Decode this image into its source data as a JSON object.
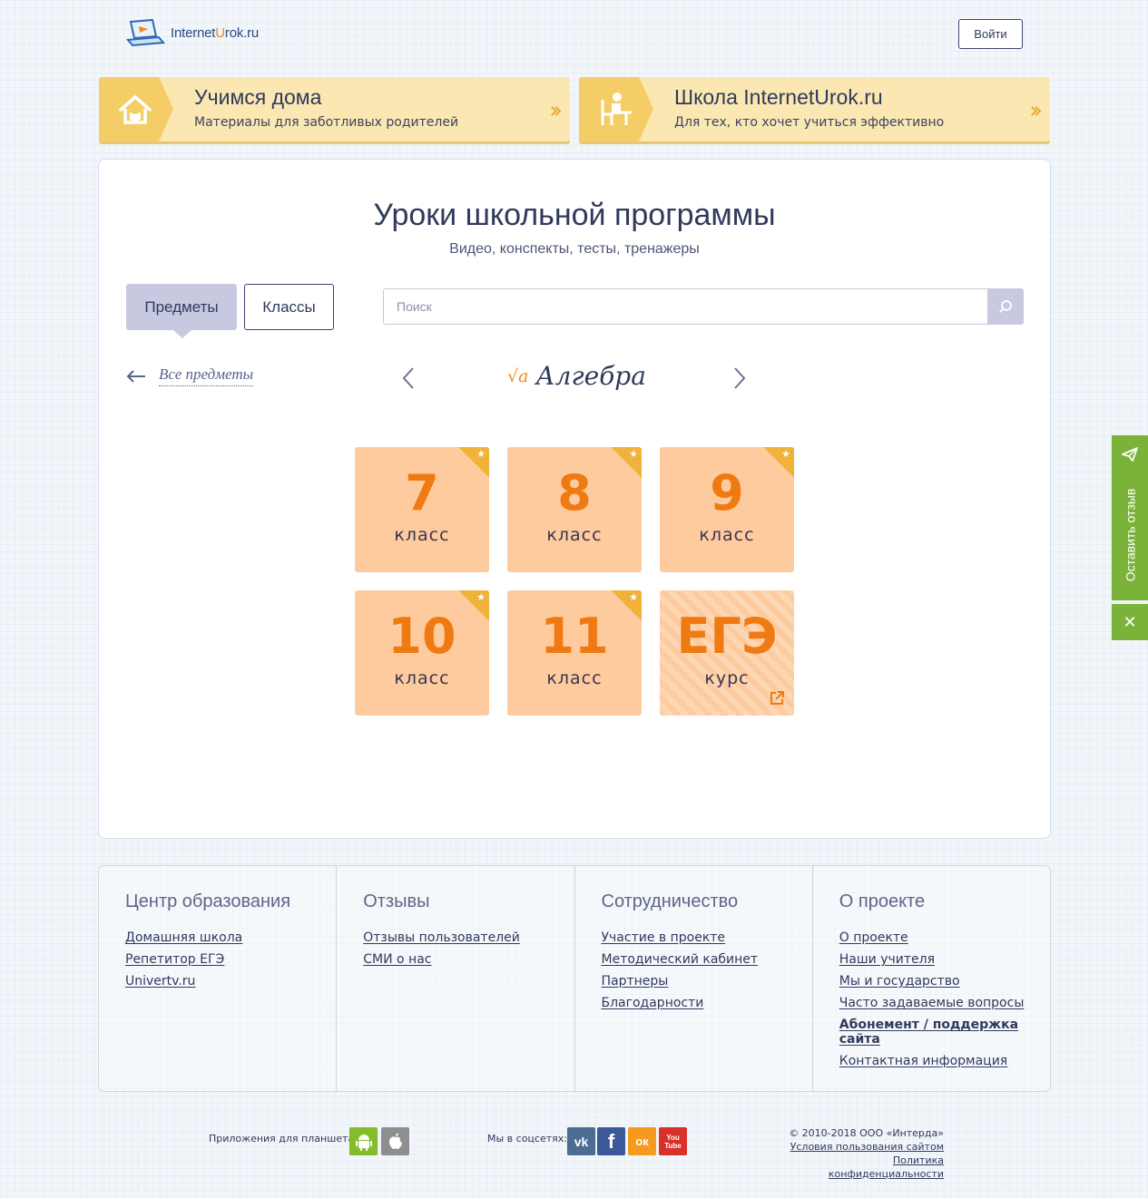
{
  "header": {
    "logo_main": "Internet",
    "logo_accent": "U",
    "logo_rest": "rok.ru",
    "login_label": "Войти"
  },
  "banners": [
    {
      "title": "Учимся дома",
      "subtitle": "Материалы для заботливых родителей",
      "icon": "house-icon"
    },
    {
      "title": "Школа InternetUrok.ru",
      "subtitle": "Для тех, кто хочет учиться эффективно",
      "icon": "student-desk-icon"
    }
  ],
  "main": {
    "title": "Уроки школьной программы",
    "subtitle": "Видео, конспекты, тесты, тренажеры",
    "tabs": [
      {
        "label": "Предметы",
        "active": true
      },
      {
        "label": "Классы",
        "active": false
      }
    ],
    "search": {
      "placeholder": "Поиск",
      "value": ""
    },
    "back_label": "Все предметы",
    "subject": {
      "name": "Алгебра",
      "icon_text": "√a"
    },
    "tiles": [
      {
        "num": "7",
        "caption": "класс",
        "starred": true
      },
      {
        "num": "8",
        "caption": "класс",
        "starred": true
      },
      {
        "num": "9",
        "caption": "класс",
        "starred": true
      },
      {
        "num": "10",
        "caption": "класс",
        "starred": true
      },
      {
        "num": "11",
        "caption": "класс",
        "starred": true
      },
      {
        "num": "ЕГЭ",
        "caption": "курс",
        "external": true
      }
    ]
  },
  "footer": {
    "columns": [
      {
        "title": "Центр образования",
        "links": [
          "Домашняя школа",
          "Репетитор ЕГЭ",
          "Univertv.ru"
        ]
      },
      {
        "title": "Отзывы",
        "links": [
          "Отзывы пользователей",
          "СМИ о нас"
        ]
      },
      {
        "title": "Сотрудничество",
        "links": [
          "Участие в проекте",
          "Методический кабинет",
          "Партнеры",
          "Благодарности"
        ]
      },
      {
        "title": "О проекте",
        "links": [
          "О проекте",
          "Наши учителя",
          "Мы и государство",
          "Часто задаваемые вопросы",
          "Абонемент / поддержка сайта",
          "Контактная информация"
        ]
      }
    ]
  },
  "bottom": {
    "apps_label": "Приложения для планшета:",
    "social_label": "Мы в соцсетях:",
    "social": {
      "vk": "vk",
      "fb": "f",
      "ok": "ок",
      "yt_top": "You",
      "yt_bottom": "Tube"
    },
    "copyright": "© 2010-2018 ООО «Интерда»",
    "terms": "Условия пользования сайтом",
    "privacy": "Политика конфиденциальности"
  },
  "feedback": {
    "label": "Оставить отзыв",
    "close": "✕"
  },
  "colors": {
    "tile": "#fecb9e",
    "tile_number": "#f07a12",
    "banner": "#fbe7b1",
    "feedback": "#7bb33a",
    "tab_active": "#c6c9e0"
  }
}
